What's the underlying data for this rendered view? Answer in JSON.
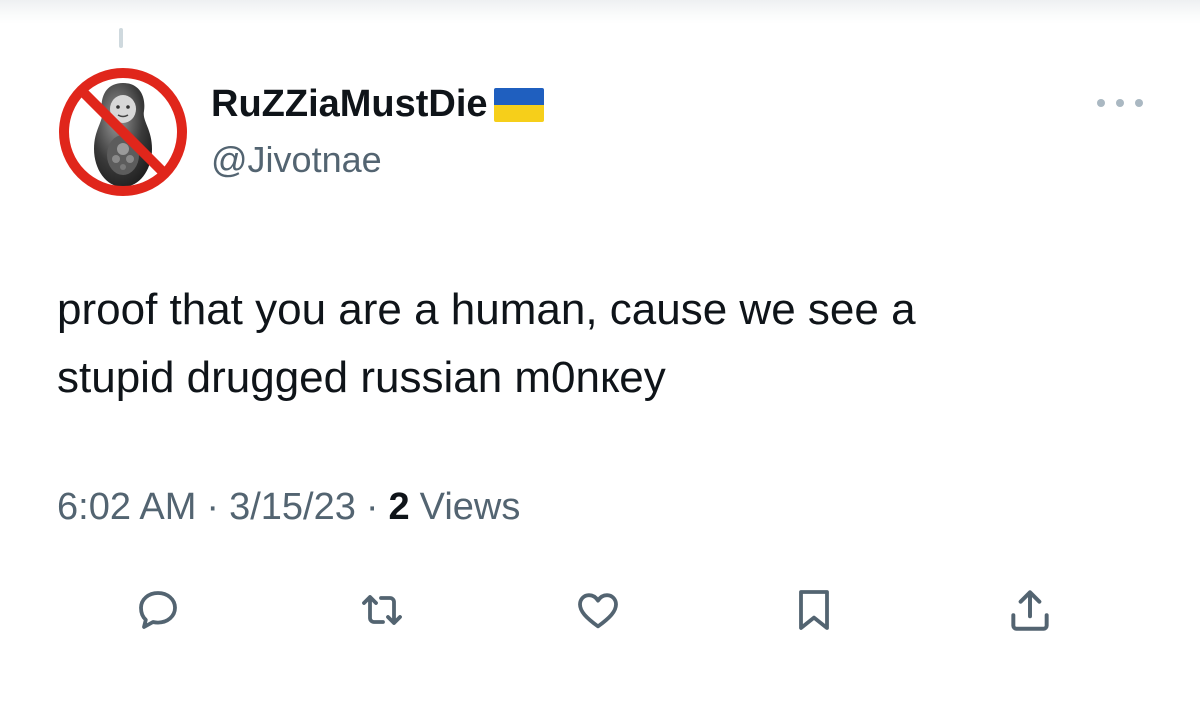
{
  "author": {
    "display_name": "RuZZiaMustDie",
    "handle": "@Jivotnae",
    "name_emoji_icon": "ukraine-flag-icon",
    "avatar_icon": "crossed-out-matryoshka-avatar"
  },
  "tweet": {
    "text_line1": "proof that you are a human, cause we see a",
    "text_line2": "stupid drugged russian m0nкey"
  },
  "meta": {
    "time": "6:02 AM",
    "separator": "·",
    "date": "3/15/23",
    "views_count": "2",
    "views_label": "Views"
  },
  "actions": [
    {
      "icon": "reply-icon"
    },
    {
      "icon": "retweet-icon"
    },
    {
      "icon": "like-icon"
    },
    {
      "icon": "bookmark-icon"
    },
    {
      "icon": "share-icon"
    }
  ],
  "colors": {
    "primary_text": "#0f1419",
    "secondary_text": "#536471",
    "icon": "#536471",
    "prohibition_red": "#e0261b",
    "flag_blue": "#1f5fbf",
    "flag_yellow": "#f6cf1a"
  }
}
